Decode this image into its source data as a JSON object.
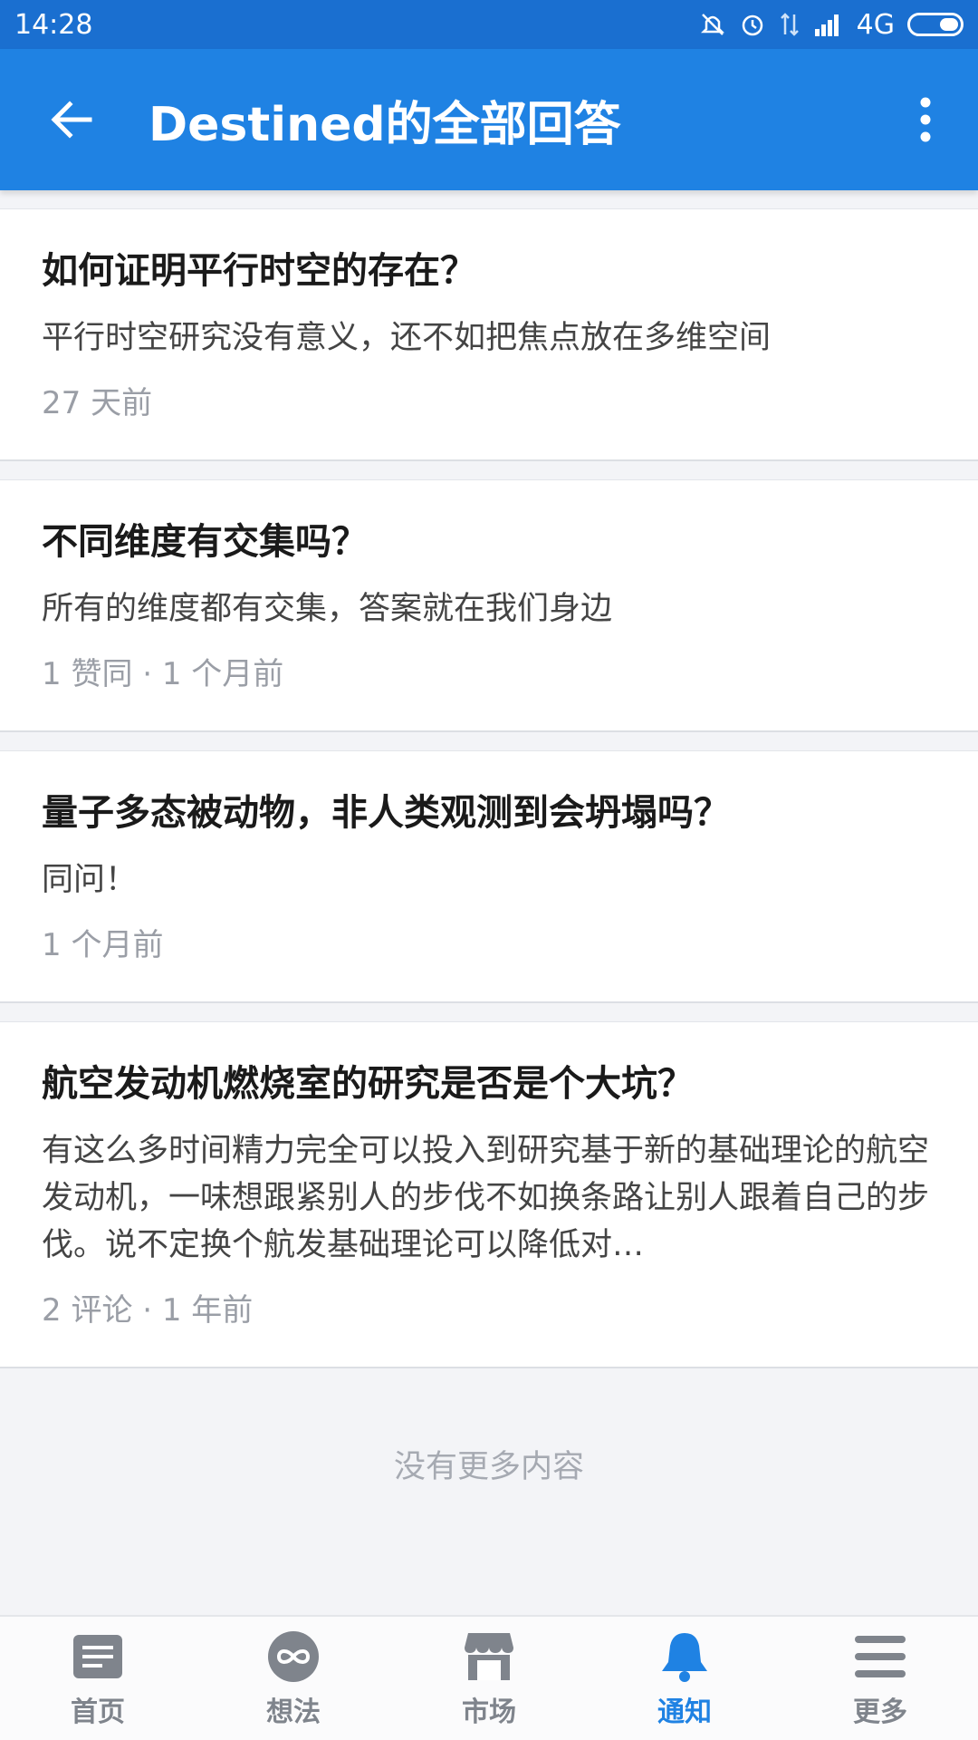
{
  "status_bar": {
    "time": "14:28",
    "network": "4G",
    "icons": [
      "mute-icon",
      "alarm-icon",
      "data-icon",
      "signal-icon",
      "battery-icon"
    ]
  },
  "app_bar": {
    "title": "Destined的全部回答",
    "back_icon": "back-arrow-icon",
    "menu_icon": "more-vertical-icon"
  },
  "answers": [
    {
      "title": "如何证明平行时空的存在？",
      "excerpt": "平行时空研究没有意义，还不如把焦点放在多维空间",
      "meta": "27 天前"
    },
    {
      "title": "不同维度有交集吗？",
      "excerpt": "所有的维度都有交集，答案就在我们身边",
      "meta": "1 赞同 · 1 个月前"
    },
    {
      "title": "量子多态被动物，非人类观测到会坍塌吗？",
      "excerpt": "同问！",
      "meta": "1 个月前"
    },
    {
      "title": "航空发动机燃烧室的研究是否是个大坑？",
      "excerpt": "有这么多时间精力完全可以投入到研究基于新的基础理论的航空发动机，一味想跟紧别人的步伐不如换条路让别人跟着自己的步伐。说不定换个航发基础理论可以降低对…",
      "meta": "2 评论 · 1 年前"
    }
  ],
  "end_text": "没有更多内容",
  "bottom_nav": {
    "active_color": "#1f82e3",
    "items": [
      {
        "label": "首页",
        "icon": "home-icon"
      },
      {
        "label": "想法",
        "icon": "ideas-icon"
      },
      {
        "label": "市场",
        "icon": "market-icon"
      },
      {
        "label": "通知",
        "icon": "bell-icon",
        "active": true
      },
      {
        "label": "更多",
        "icon": "menu-icon"
      }
    ]
  }
}
